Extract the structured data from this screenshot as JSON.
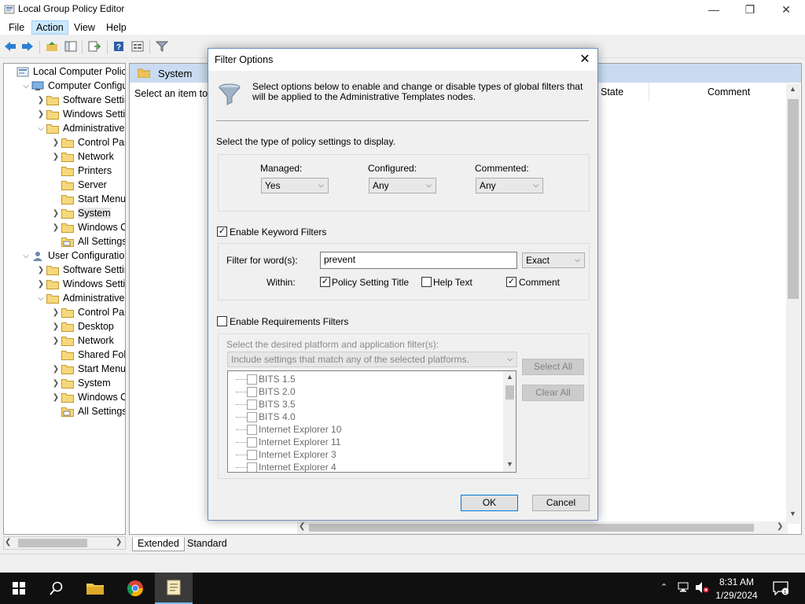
{
  "window": {
    "title": "Local Group Policy Editor"
  },
  "menu": [
    "File",
    "Action",
    "View",
    "Help"
  ],
  "tree": {
    "items": [
      {
        "label": "Local Computer Policy"
      },
      {
        "label": "Computer Configura"
      },
      {
        "label": "Software Settings"
      },
      {
        "label": "Windows Setting"
      },
      {
        "label": "Administrative Te"
      },
      {
        "label": "Control Panel"
      },
      {
        "label": "Network"
      },
      {
        "label": "Printers"
      },
      {
        "label": "Server"
      },
      {
        "label": "Start Menu ar"
      },
      {
        "label": "System"
      },
      {
        "label": "Windows Cor"
      },
      {
        "label": "All Settings"
      },
      {
        "label": "User Configuration"
      },
      {
        "label": "Software Settings"
      },
      {
        "label": "Windows Setting"
      },
      {
        "label": "Administrative Te"
      },
      {
        "label": "Control Panel"
      },
      {
        "label": "Desktop"
      },
      {
        "label": "Network"
      },
      {
        "label": "Shared Folder"
      },
      {
        "label": "Start Menu ar"
      },
      {
        "label": "System"
      },
      {
        "label": "Windows Cor"
      },
      {
        "label": "All Settings"
      }
    ]
  },
  "right_pane": {
    "title": "System",
    "hint": "Select an item to v",
    "columns": {
      "state": "State",
      "comment": "Comment"
    }
  },
  "tabs": {
    "extended": "Extended",
    "standard": "Standard"
  },
  "dialog": {
    "title": "Filter Options",
    "description_line1": "Select options below to enable and change or disable types of global filters that",
    "description_line2": "will be applied to the Administrative Templates nodes.",
    "type_section_label": "Select the type of policy settings to display.",
    "managed": {
      "label": "Managed:",
      "value": "Yes"
    },
    "configured": {
      "label": "Configured:",
      "value": "Any"
    },
    "commented": {
      "label": "Commented:",
      "value": "Any"
    },
    "keyword": {
      "enable_label": "Enable Keyword Filters",
      "enabled": true,
      "filter_label": "Filter for word(s):",
      "filter_value": "prevent",
      "match_value": "Exact",
      "within_label": "Within:",
      "policy_title_label": "Policy Setting Title",
      "policy_title_checked": true,
      "help_text_label": "Help Text",
      "help_text_checked": false,
      "comment_label": "Comment",
      "comment_checked": true
    },
    "requirements": {
      "enable_label": "Enable Requirements Filters",
      "enabled": false,
      "platform_label": "Select the desired platform and application filter(s):",
      "match_value": "Include settings that match any of the selected platforms.",
      "select_all": "Select All",
      "clear_all": "Clear All",
      "platforms": [
        "BITS 1.5",
        "BITS 2.0",
        "BITS 3.5",
        "BITS 4.0",
        "Internet Explorer 10",
        "Internet Explorer 11",
        "Internet Explorer 3",
        "Internet Explorer 4"
      ]
    },
    "ok_label": "OK",
    "cancel_label": "Cancel"
  },
  "taskbar": {
    "time": "8:31 AM",
    "date": "1/29/2024"
  },
  "colors": {
    "accent": "#0078d7",
    "pane_header": "#c9dbf0",
    "taskbar": "#101010",
    "folder": "#e8c25c"
  }
}
